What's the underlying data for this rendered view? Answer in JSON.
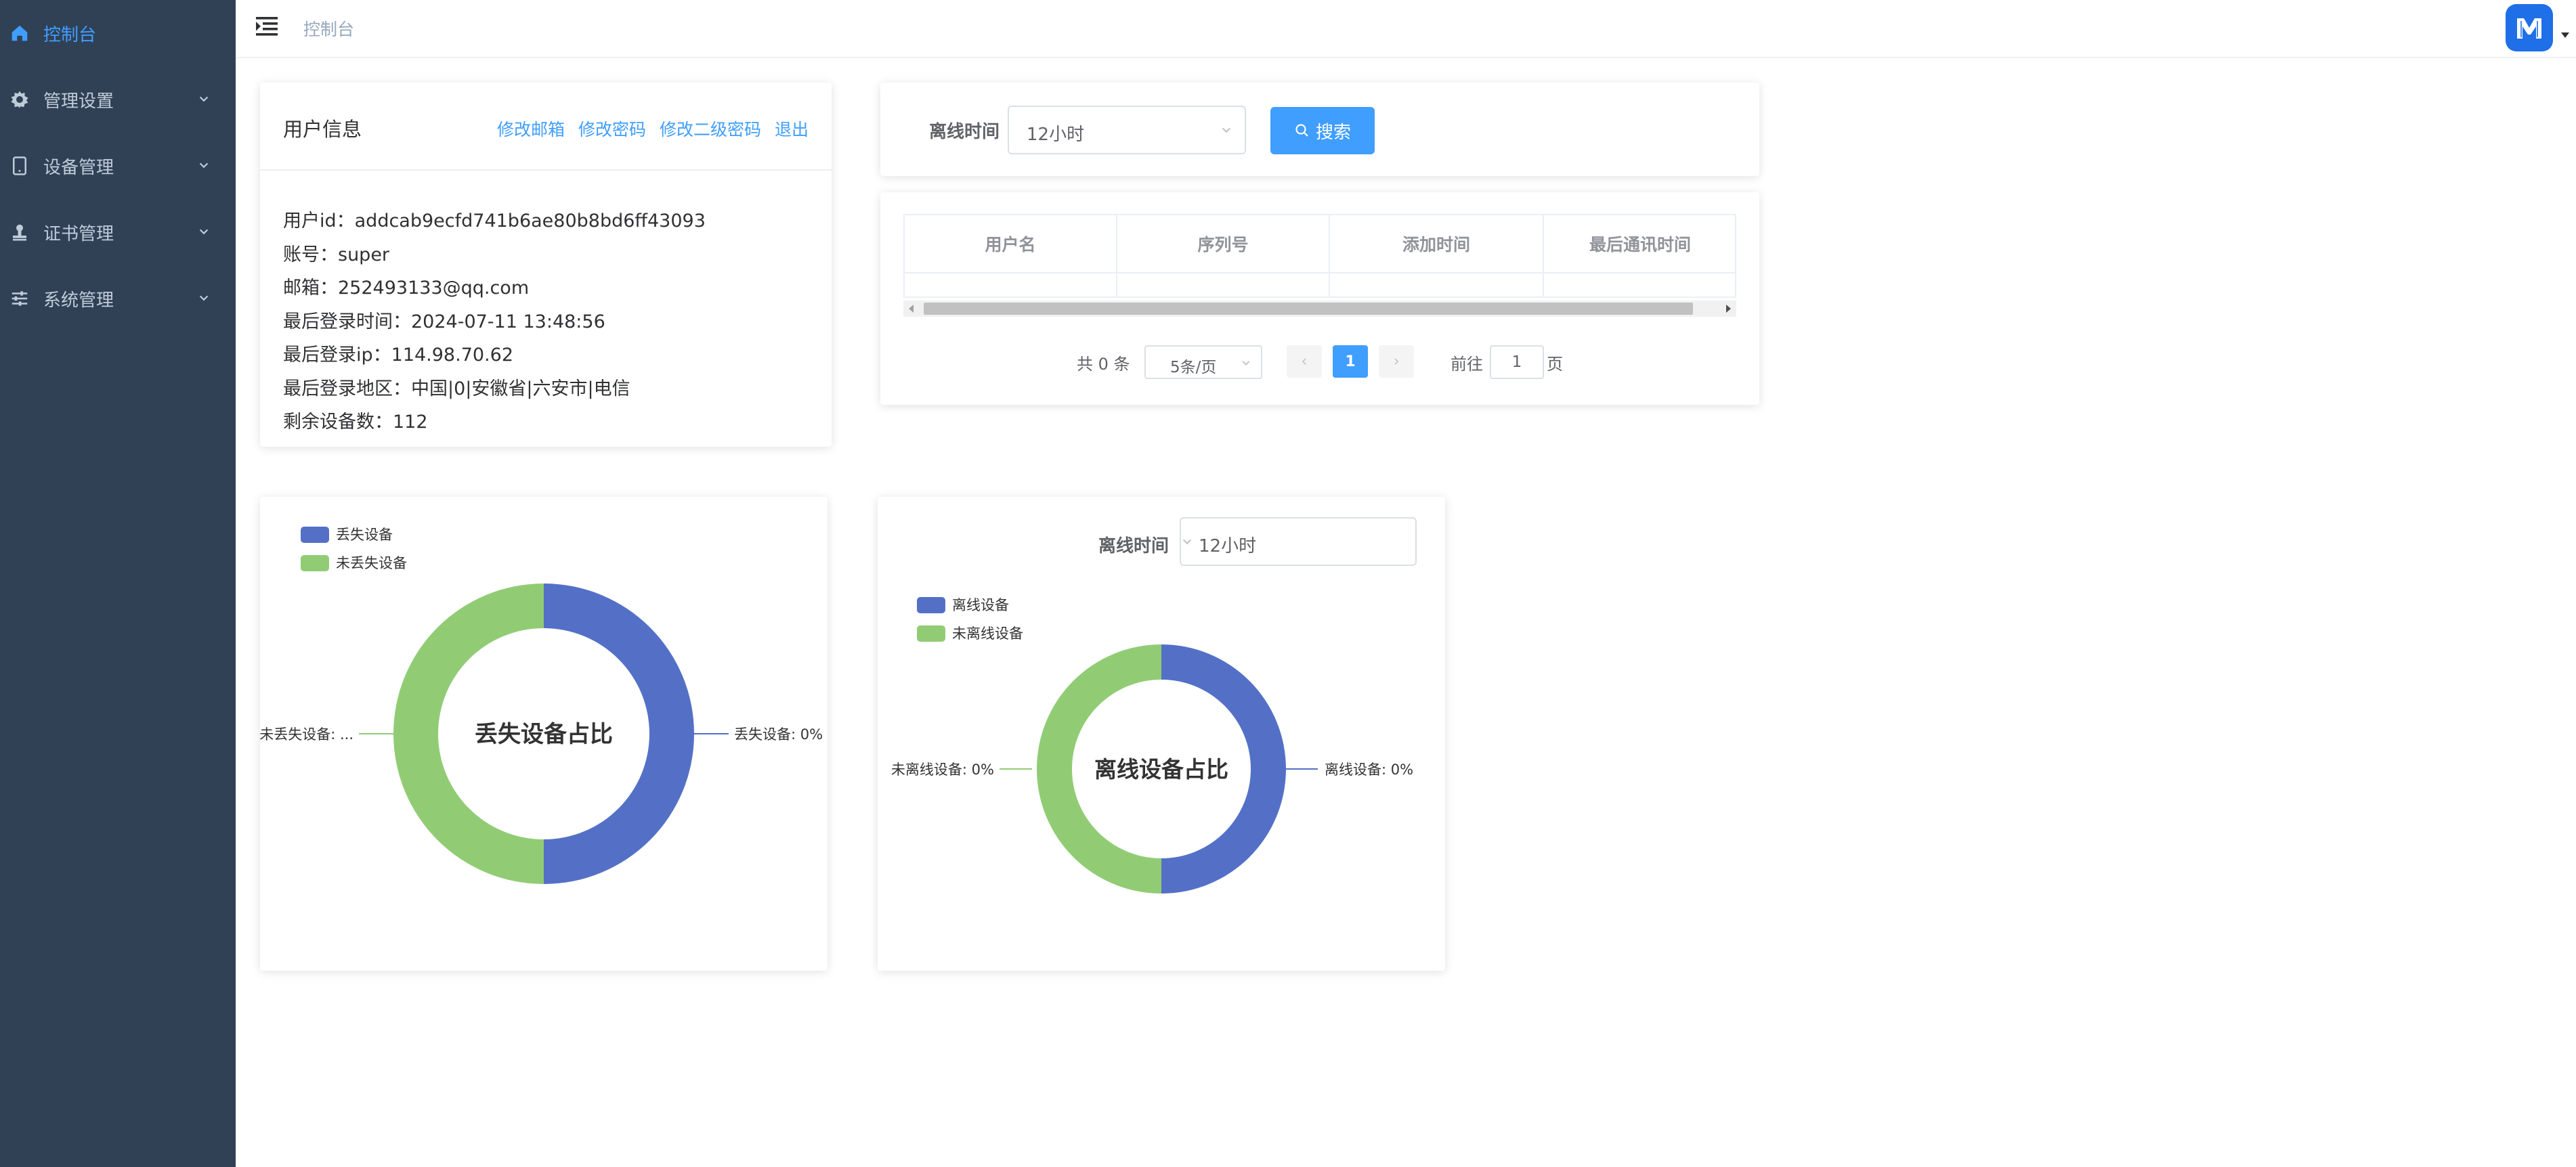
{
  "sidebar": {
    "items": [
      {
        "label": "控制台",
        "icon": "home-icon",
        "active": true
      },
      {
        "label": "管理设置",
        "icon": "gear-icon",
        "active": false
      },
      {
        "label": "设备管理",
        "icon": "tablet-icon",
        "active": false
      },
      {
        "label": "证书管理",
        "icon": "stamp-icon",
        "active": false
      },
      {
        "label": "系统管理",
        "icon": "sliders-icon",
        "active": false
      }
    ]
  },
  "header": {
    "breadcrumb": "控制台",
    "menu_icon": "menu-fold-icon",
    "logo_icon": "app-logo"
  },
  "user_info": {
    "title": "用户信息",
    "links": [
      "修改邮箱",
      "修改密码",
      "修改二级密码",
      "退出"
    ],
    "lines": [
      "用户id：addcab9ecfd741b6ae80b8bd6ff43093",
      "账号：super",
      "邮箱：252493133@qq.com",
      "最后登录时间：2024-07-11 13:48:56",
      "最后登录ip：114.98.70.62",
      "最后登录地区：中国|0|安徽省|六安市|电信",
      "剩余设备数：112"
    ]
  },
  "search": {
    "label": "离线时间",
    "select_value": "12小时",
    "button_label": "搜索"
  },
  "table": {
    "columns": [
      "用户名",
      "序列号",
      "添加时间",
      "最后通讯时间"
    ],
    "rows": []
  },
  "pagination": {
    "total": "共 0 条",
    "page_size": "5条/页",
    "current_page": "1",
    "goto_prefix": "前往",
    "goto_value": "1",
    "goto_suffix": "页"
  },
  "lost_chart": {
    "legend": [
      "丢失设备",
      "未丢失设备"
    ],
    "center_title": "丢失设备占比",
    "label_right": "丢失设备: 0%",
    "label_left": "未丢失设备: ..."
  },
  "offline_chart": {
    "filter_label": "离线时间",
    "filter_value": "12小时",
    "legend": [
      "离线设备",
      "未离线设备"
    ],
    "center_title": "离线设备占比",
    "label_right": "离线设备: 0%",
    "label_left": "未离线设备: 0%"
  },
  "colors": {
    "sidebar_bg": "#304156",
    "accent": "#409eff",
    "series_blue": "#5470c6",
    "series_green": "#91cc75"
  },
  "chart_data": [
    {
      "type": "pie",
      "title": "丢失设备占比",
      "categories": [
        "丢失设备",
        "未丢失设备"
      ],
      "values": [
        50,
        50
      ]
    },
    {
      "type": "pie",
      "title": "离线设备占比",
      "categories": [
        "离线设备",
        "未离线设备"
      ],
      "values": [
        50,
        50
      ]
    }
  ]
}
